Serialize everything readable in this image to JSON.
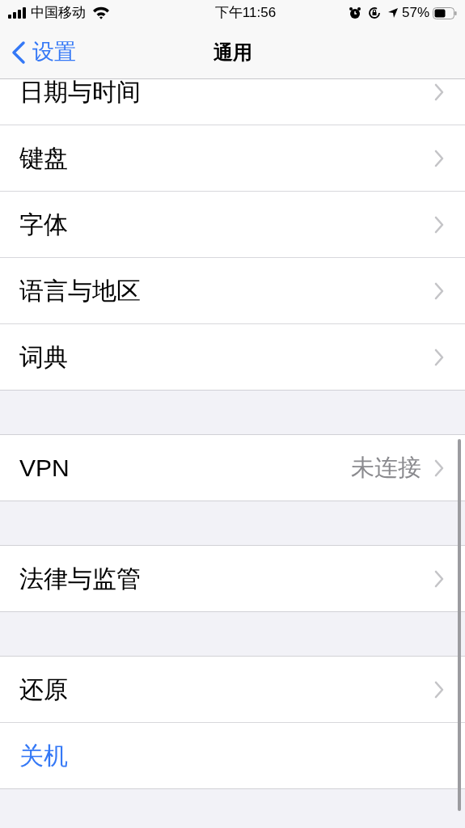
{
  "status_bar": {
    "carrier": "中国移动",
    "time": "下午11:56",
    "battery": "57%"
  },
  "nav": {
    "back": "设置",
    "title": "通用"
  },
  "sections": [
    {
      "rows": [
        {
          "label": "日期与时间",
          "kind": "link"
        },
        {
          "label": "键盘",
          "kind": "link"
        },
        {
          "label": "字体",
          "kind": "link"
        },
        {
          "label": "语言与地区",
          "kind": "link"
        },
        {
          "label": "词典",
          "kind": "link"
        }
      ]
    },
    {
      "rows": [
        {
          "label": "VPN",
          "kind": "link",
          "value": "未连接"
        }
      ]
    },
    {
      "rows": [
        {
          "label": "法律与监管",
          "kind": "link"
        }
      ]
    },
    {
      "rows": [
        {
          "label": "还原",
          "kind": "link"
        },
        {
          "label": "关机",
          "kind": "action"
        }
      ]
    }
  ]
}
